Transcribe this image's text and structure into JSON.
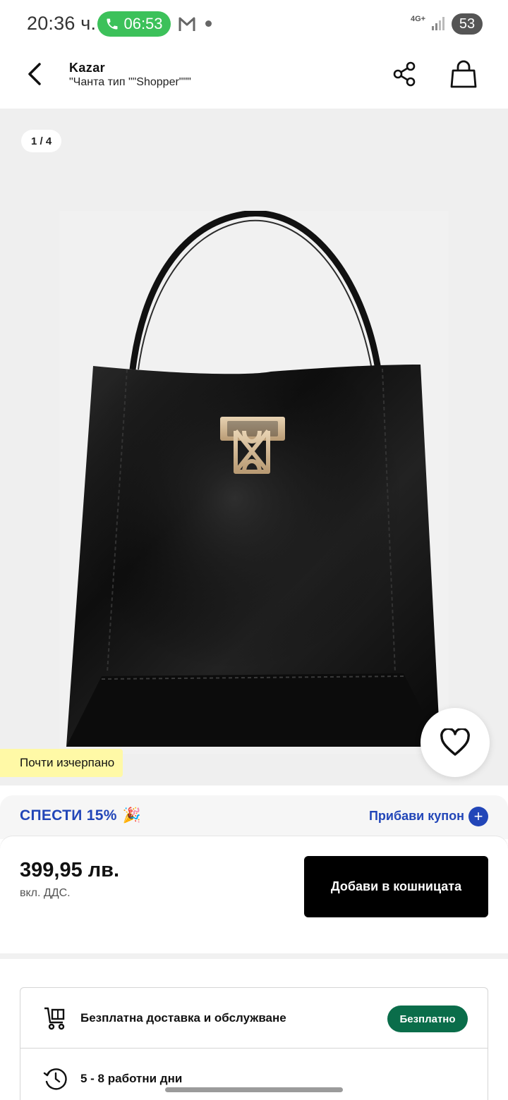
{
  "status_bar": {
    "time": "20:36 ч.",
    "call_time": "06:53",
    "network": "4G+",
    "battery": "53"
  },
  "header": {
    "brand": "Kazar",
    "subtitle": "\"Чанта тип \"\"Shopper\"\"\""
  },
  "gallery": {
    "counter": "1 / 4",
    "stock_badge": "Почти изчерпано"
  },
  "savings": {
    "label": "СПЕСТИ 15%",
    "coupon_label": "Прибави купон",
    "emoji": "🎉"
  },
  "price_box": {
    "price": "399,95 лв.",
    "vat_note": "вкл. ДДС.",
    "add_to_cart": "Добави в кошницата"
  },
  "delivery": {
    "rows": [
      {
        "text": "Безплатна доставка и обслужване",
        "badge": "Безплатно"
      },
      {
        "text": "5 - 8 работни дни"
      }
    ]
  },
  "colors": {
    "accent_blue": "#2246b8",
    "badge_green": "#0a6d4a",
    "call_green": "#3cc15a",
    "stock_yellow": "#fff9a6"
  },
  "icons": [
    "back-arrow-icon",
    "share-icon",
    "shopping-bag-icon",
    "heart-icon",
    "plus-icon",
    "delivery-cart-icon",
    "clock-icon"
  ]
}
